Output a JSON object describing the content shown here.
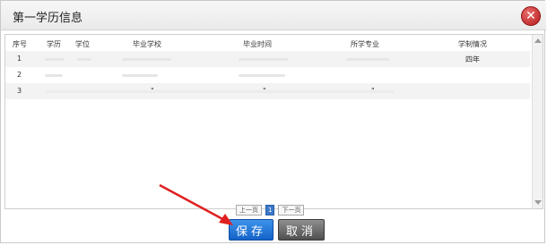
{
  "dialog": {
    "title": "第一学历信息",
    "close_icon": "close-icon",
    "close_color": "#c0392b"
  },
  "table": {
    "headers": [
      "序号",
      "学历",
      "学位",
      "毕业学校",
      "毕业时间",
      "所学专业",
      "学制情况"
    ],
    "rows": [
      {
        "index": "1",
        "duration": "四年"
      },
      {
        "index": "2"
      },
      {
        "index": "3",
        "school_mark": "\"",
        "time_mark": "\"",
        "major_mark": "\""
      }
    ]
  },
  "pager": {
    "prev": "上一页",
    "current": "1",
    "next": "下一页"
  },
  "actions": {
    "save": "保存",
    "cancel": "取消"
  },
  "colors": {
    "accent": "#1d6fd6",
    "arrow": "#e02020"
  }
}
